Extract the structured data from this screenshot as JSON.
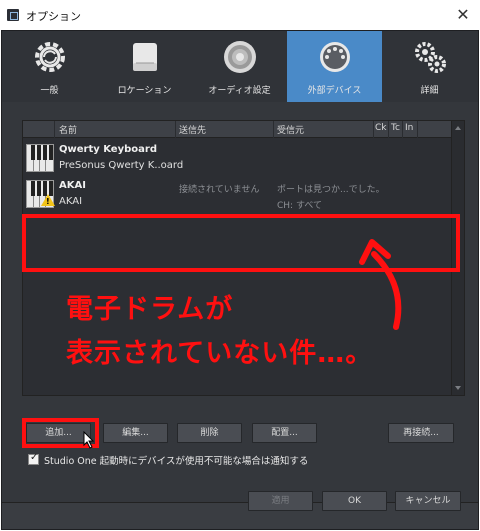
{
  "window": {
    "title": "オプション",
    "close_glyph": "✕"
  },
  "tabs": [
    {
      "label": "一般",
      "icon": "gear-refresh-icon",
      "active": false
    },
    {
      "label": "ロケーション",
      "icon": "drive-icon",
      "active": false
    },
    {
      "label": "オーディオ設定",
      "icon": "speaker-icon",
      "active": false
    },
    {
      "label": "外部デバイス",
      "icon": "midi-port-icon",
      "active": true
    },
    {
      "label": "詳細",
      "icon": "gears-icon",
      "active": false
    }
  ],
  "device_list": {
    "columns": [
      "名前",
      "送信先",
      "受信元",
      "Ck",
      "Tc",
      "In"
    ],
    "rows": [
      {
        "name": "Qwerty Keyboard",
        "subname": "PreSonus Qwerty K..oard",
        "send": "",
        "receive": "",
        "receive_sub": "",
        "warning": false
      },
      {
        "name": "AKAI",
        "subname": "AKAI",
        "send": "接続されていません",
        "receive": "ポートは見つか...でした。",
        "receive_sub": "CH: すべて",
        "warning": true
      }
    ]
  },
  "annotation": {
    "line1": "電子ドラムが",
    "line2": "表示されていない件…。",
    "color": "#ff1010"
  },
  "buttons": {
    "add": "追加...",
    "edit": "編集...",
    "delete": "削除",
    "arrange": "配置...",
    "reconnect": "再接続...",
    "apply": "適用",
    "ok": "OK",
    "cancel": "キャンセル"
  },
  "notify_checkbox": {
    "checked": true,
    "label": "Studio One 起動時にデバイスが使用不可能な場合は通知する",
    "mark": "✓"
  },
  "colors": {
    "accent": "#4a8ac8",
    "panel": "#34373c",
    "list_bg": "#2c2e33"
  }
}
